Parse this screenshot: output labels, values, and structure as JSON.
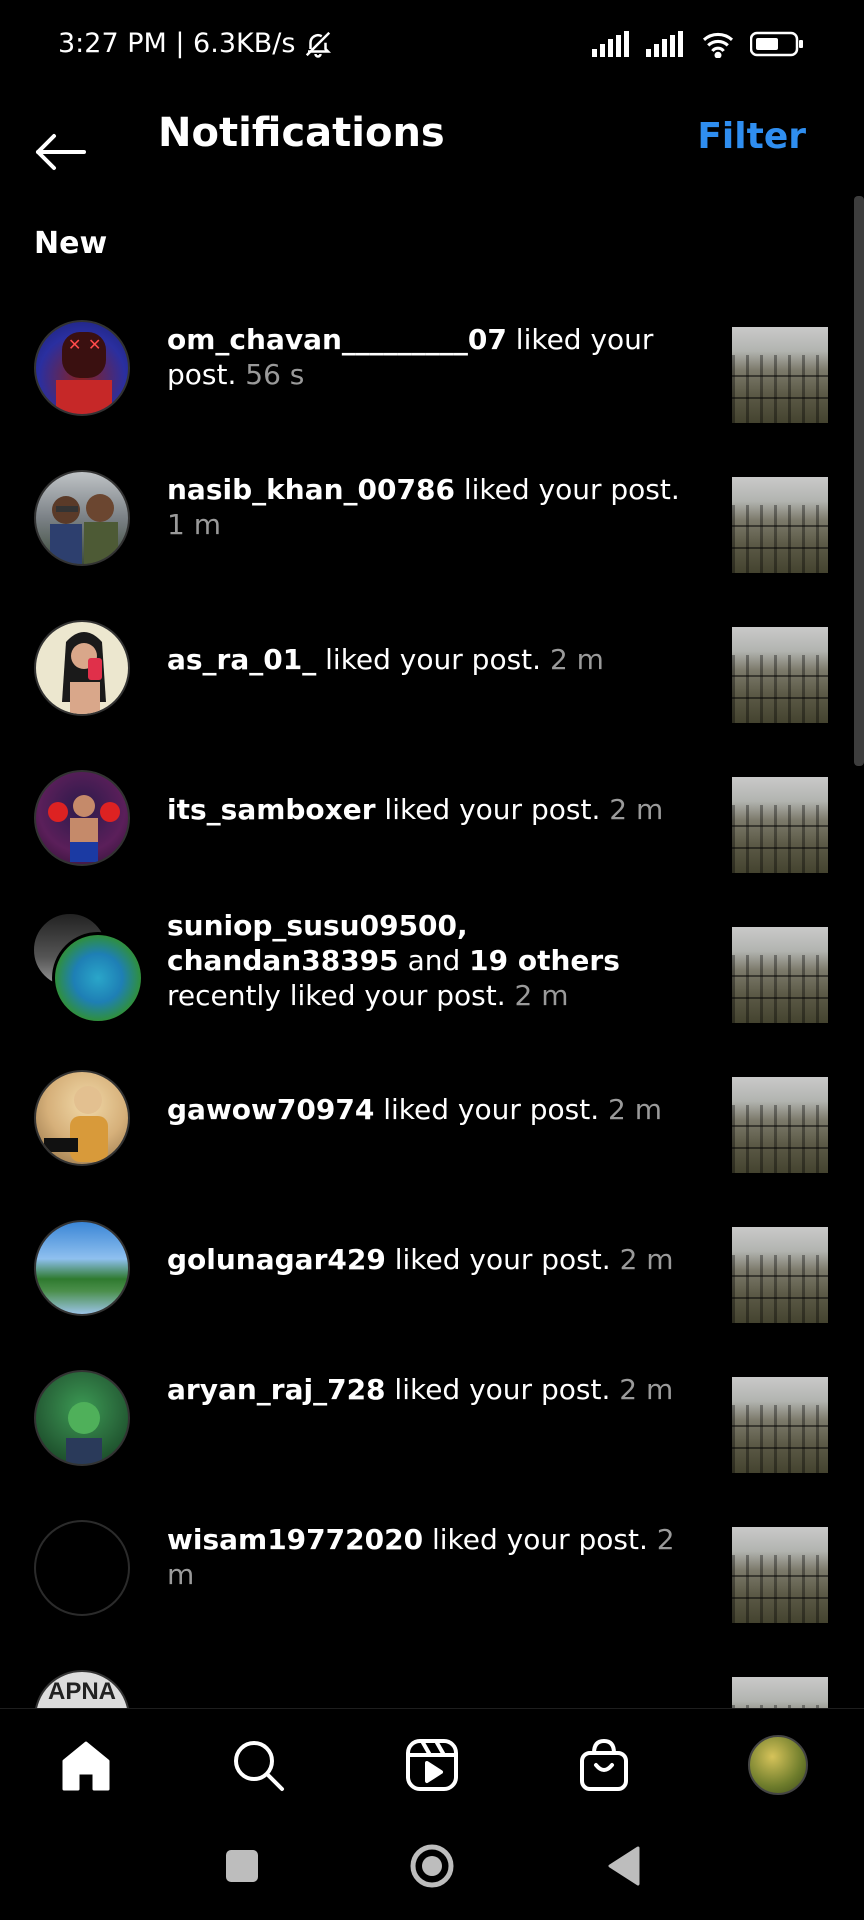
{
  "status": {
    "time_speed": "3:27 PM | 6.3KB/s"
  },
  "header": {
    "title": "Notifications",
    "filter": "Filter"
  },
  "section_label": "New",
  "notifications": [
    {
      "user": "om_chavan_________07",
      "action": " liked your post.",
      "time": "56 s",
      "avatar_color": "#2a2fa0"
    },
    {
      "user": "nasib_khan_00786",
      "action": " liked your post.",
      "time": "1 m",
      "avatar_color": "#6a6f72"
    },
    {
      "user": "as_ra_01_",
      "action": " liked your post.",
      "time": "2 m",
      "avatar_color": "#e8e1c8"
    },
    {
      "user": "its_samboxer",
      "action": " liked your post.",
      "time": "2 m",
      "avatar_color": "#7a2a6a"
    },
    {
      "user": "suniop_susu09500, chandan38395",
      "user2": "19 others",
      "action": " recently liked your post.",
      "time": "2 m",
      "avatar_color": "#1e7fb5"
    },
    {
      "user": "gawow70974",
      "action": " liked your post.",
      "time": "2 m",
      "avatar_color": "#d6b07a"
    },
    {
      "user": "golunagar429",
      "action": " liked your post.",
      "time": "2 m",
      "avatar_color": "#4a8cd4"
    },
    {
      "user": "aryan_raj_728",
      "action": " liked your post.",
      "time": "2 m",
      "avatar_color": "#2a6a3c"
    },
    {
      "user": "wisam19772020",
      "action": " liked your post.",
      "time": "2 m",
      "avatar_color": "#000000"
    }
  ],
  "partial_row_avatar_text": "APNA",
  "icons": {
    "back": "arrow-left-icon",
    "home": "home-icon",
    "search": "search-icon",
    "reels": "reels-icon",
    "shop": "shop-bag-icon"
  },
  "colors": {
    "background": "#000000",
    "accent": "#2f8ef0",
    "time_text": "#9a9a9a"
  }
}
